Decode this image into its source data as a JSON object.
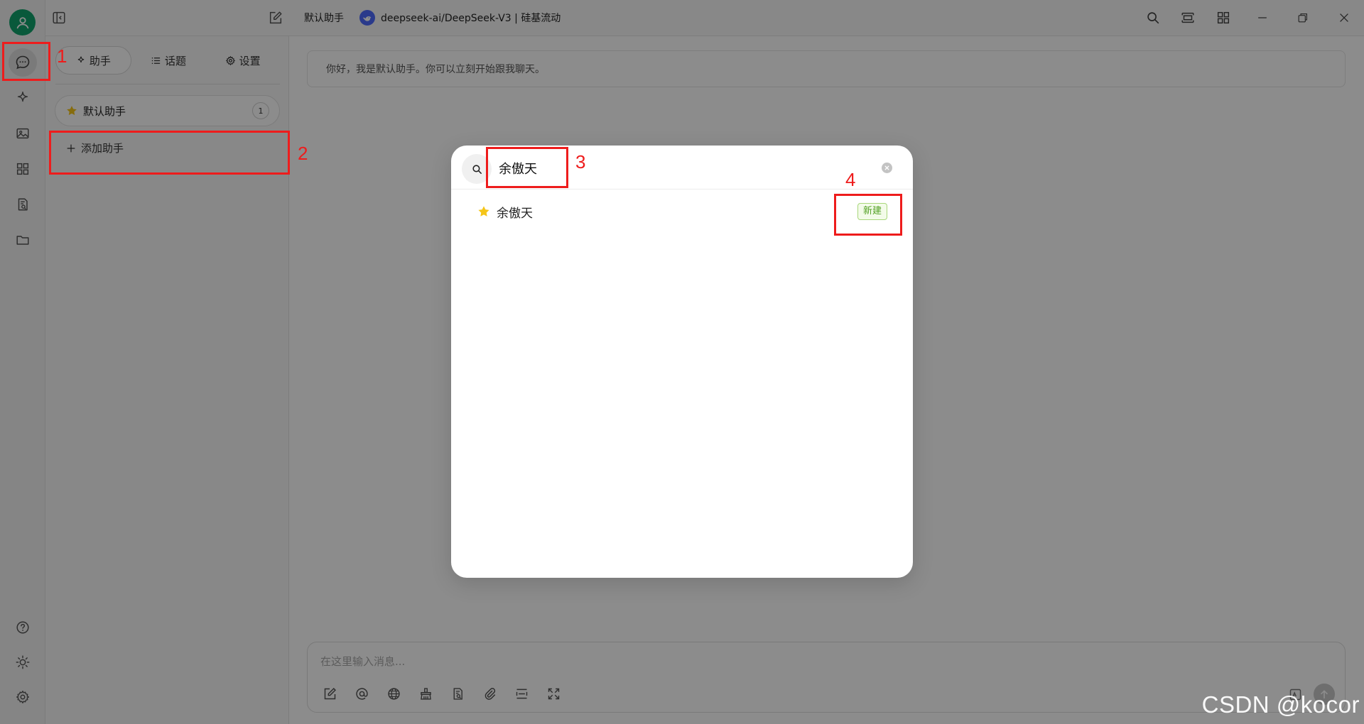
{
  "topbar": {
    "assistant_title": "默认助手",
    "model_name": "deepseek-ai/DeepSeek-V3 | 硅基流动"
  },
  "sidebar_tabs": [
    {
      "label": "助手",
      "icon": "sparkle-icon"
    },
    {
      "label": "话题",
      "icon": "list-icon"
    },
    {
      "label": "设置",
      "icon": "gear-icon"
    }
  ],
  "assistants": [
    {
      "name": "默认助手",
      "count": "1"
    }
  ],
  "add_assistant_label": "添加助手",
  "chat": {
    "welcome": "你好，我是默认助手。你可以立刻开始跟我聊天。",
    "input_placeholder": "在这里输入消息..."
  },
  "modal": {
    "search_value": "余傲天",
    "results": [
      {
        "name": "余傲天",
        "badge": "新建"
      }
    ]
  },
  "annotations": [
    "1",
    "2",
    "3",
    "4"
  ],
  "watermark": "CSDN @kocor",
  "colors": {
    "avatar_green": "#11a26c",
    "annotation_red": "#ee1c1c",
    "star_yellow": "#f5c518",
    "badge_green": "#52a023",
    "deepseek_blue": "#4d6bfe"
  }
}
